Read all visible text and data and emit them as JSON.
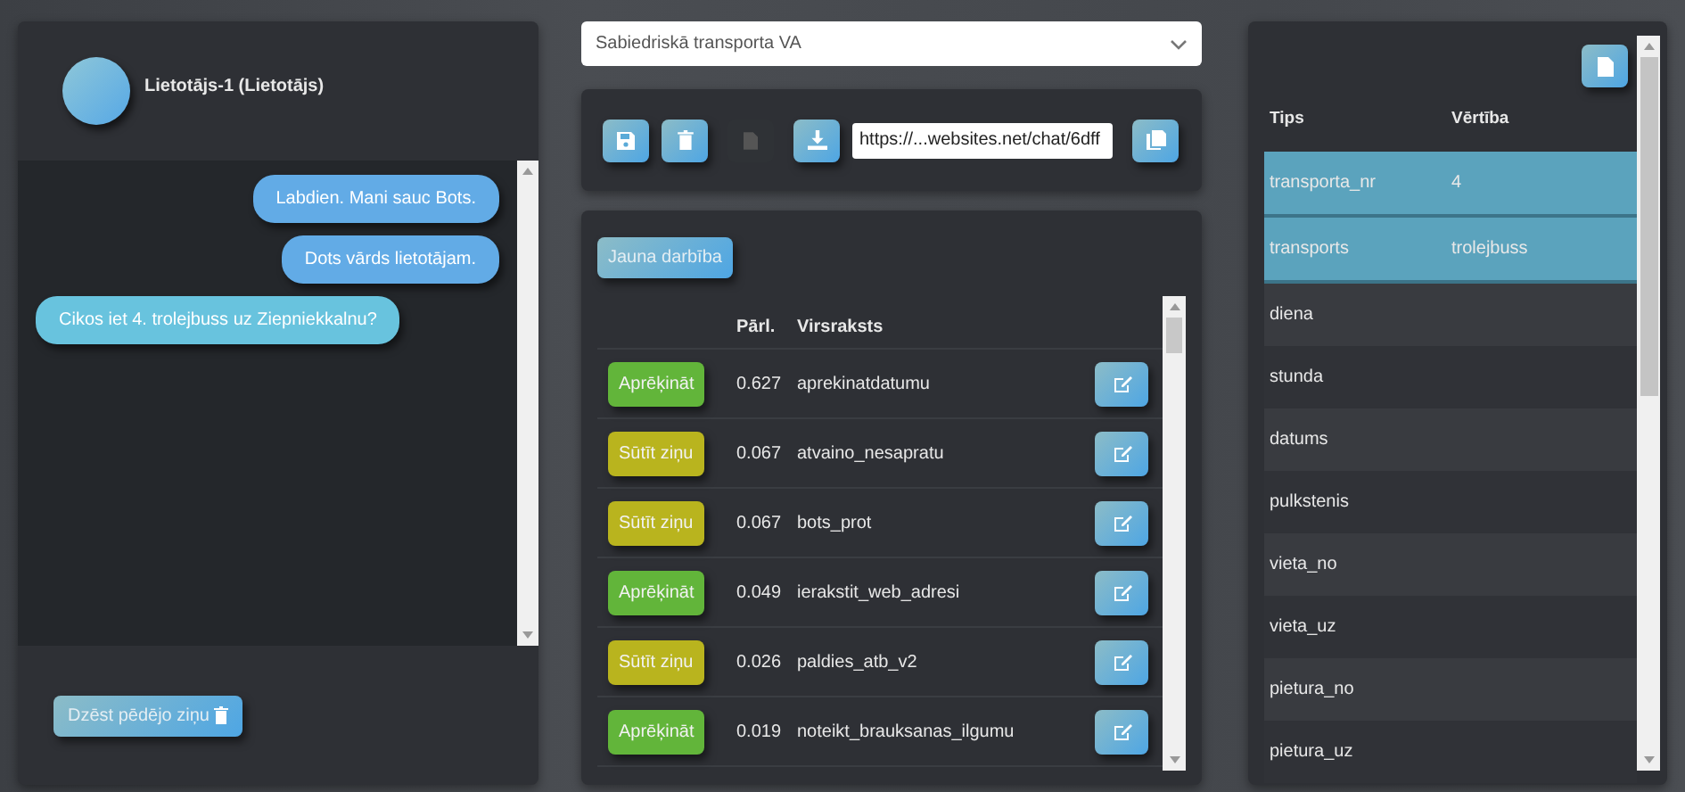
{
  "user": {
    "name": "Lietotājs-1 (Lietotājs)"
  },
  "messages": [
    {
      "kind": "bot",
      "text": "Labdien. Mani sauc Bots."
    },
    {
      "kind": "bot",
      "text": "Dots vārds lietotājam."
    },
    {
      "kind": "user",
      "text": "Cikos iet 4. trolejbuss uz Ziepniekkalnu?"
    }
  ],
  "delete_button": {
    "label": "Dzēst pēdējo ziņu"
  },
  "scenario_select": {
    "value": "Sabiedriskā transporta VA"
  },
  "toolbar": {
    "buttons": [
      {
        "kind": "save",
        "disabled": false
      },
      {
        "kind": "delete",
        "disabled": false
      },
      {
        "kind": "file",
        "disabled": true
      },
      {
        "kind": "download",
        "disabled": false
      }
    ],
    "url": "https://...websites.net/chat/6dff"
  },
  "actions": {
    "new_button": "Jauna darbība",
    "columns": [
      "Pārl.",
      "Virsraksts"
    ],
    "rows": [
      {
        "kind": "calculate",
        "button": "Aprēķināt",
        "score": "0.627",
        "title": "aprekinatdatumu"
      },
      {
        "kind": "message",
        "button": "Sūtīt ziņu",
        "score": "0.067",
        "title": "atvaino_nesapratu"
      },
      {
        "kind": "message",
        "button": "Sūtīt ziņu",
        "score": "0.067",
        "title": "bots_prot"
      },
      {
        "kind": "calculate",
        "button": "Aprēķināt",
        "score": "0.049",
        "title": "ierakstit_web_adresi"
      },
      {
        "kind": "message",
        "button": "Sūtīt ziņu",
        "score": "0.026",
        "title": "paldies_atb_v2"
      },
      {
        "kind": "calculate",
        "button": "Aprēķināt",
        "score": "0.019",
        "title": "noteikt_brauksanas_ilgumu"
      }
    ]
  },
  "variables": {
    "columns": [
      "Tips",
      "Vērtība"
    ],
    "rows": [
      {
        "type": "transporta_nr",
        "value": "4",
        "selected": true
      },
      {
        "type": "transports",
        "value": "trolejbuss",
        "selected": true
      },
      {
        "type": "diena",
        "selected": false
      },
      {
        "type": "stunda",
        "selected": false
      },
      {
        "type": "datums",
        "selected": false
      },
      {
        "type": "pulkstenis",
        "selected": false
      },
      {
        "type": "vieta_no",
        "selected": false
      },
      {
        "type": "vieta_uz",
        "selected": false
      },
      {
        "type": "pietura_no",
        "selected": false
      },
      {
        "type": "pietura_uz",
        "selected": false
      }
    ]
  }
}
